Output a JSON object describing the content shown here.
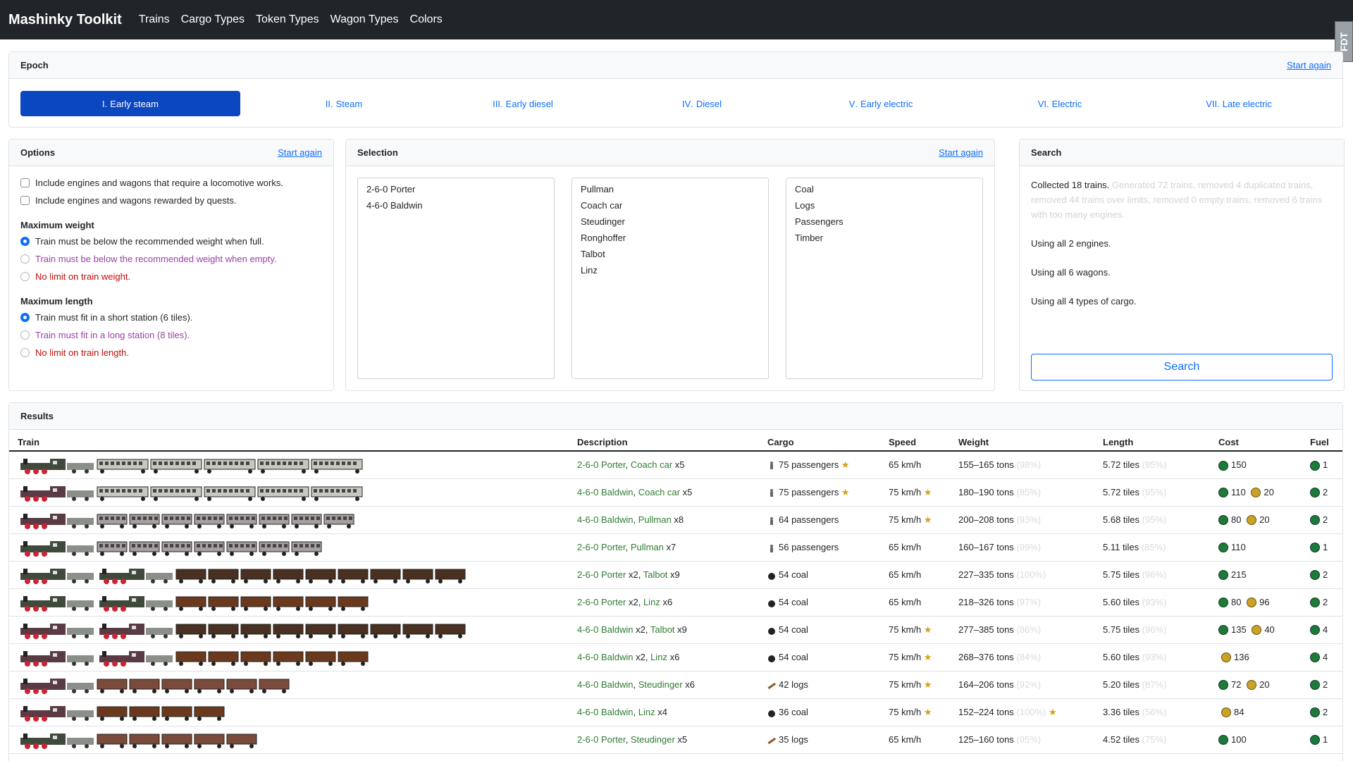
{
  "nav": {
    "brand": "Mashinky Toolkit",
    "links": [
      "Trains",
      "Cargo Types",
      "Token Types",
      "Wagon Types",
      "Colors"
    ]
  },
  "fdt": "FDT",
  "epoch": {
    "title": "Epoch",
    "start_again": "Start again",
    "items": [
      {
        "num": "I",
        "label": "Early steam"
      },
      {
        "num": "II",
        "label": "Steam"
      },
      {
        "num": "III",
        "label": "Early diesel"
      },
      {
        "num": "IV",
        "label": "Diesel"
      },
      {
        "num": "V",
        "label": "Early electric"
      },
      {
        "num": "VI",
        "label": "Electric"
      },
      {
        "num": "VII",
        "label": "Late electric"
      }
    ]
  },
  "options": {
    "title": "Options",
    "start_again": "Start again",
    "checks": [
      "Include engines and wagons that require a locomotive works.",
      "Include engines and wagons rewarded by quests."
    ],
    "weight_title": "Maximum weight",
    "weight": [
      "Train must be below the recommended weight when full.",
      "Train must be below the recommended weight when empty.",
      "No limit on train weight."
    ],
    "length_title": "Maximum length",
    "length": [
      "Train must fit in a short station (6 tiles).",
      "Train must fit in a long station (8 tiles).",
      "No limit on train length."
    ]
  },
  "selection": {
    "title": "Selection",
    "start_again": "Start again",
    "engines": [
      "2-6-0 Porter",
      "4-6-0 Baldwin"
    ],
    "wagons": [
      "Pullman",
      "Coach car",
      "Steudinger",
      "Ronghoffer",
      "Talbot",
      "Linz"
    ],
    "cargo": [
      "Coal",
      "Logs",
      "Passengers",
      "Timber"
    ]
  },
  "search": {
    "title": "Search",
    "collected": "Collected 18 trains.",
    "details": "Generated 72 trains, removed 4 duplicated trains, removed 44 trains over limits, removed 0 empty trains, removed 6 trains with too many engines.",
    "engines": "Using all 2 engines.",
    "wagons": "Using all 6 wagons.",
    "cargo": "Using all 4 types of cargo.",
    "button": "Search"
  },
  "results": {
    "title": "Results",
    "headers": [
      "Train",
      "Description",
      "Cargo",
      "Speed",
      "Weight",
      "Length",
      "Cost",
      "Fuel"
    ],
    "colors": {
      "porter": "#3f4a3c",
      "baldwin": "#5a3b44",
      "coach": "#c8c8c0",
      "pullman": "#a8a0a0",
      "talbot": "#4a3020",
      "linz": "#6b3a1e",
      "steud": "#7a4a3a"
    },
    "rows": [
      {
        "locos": [
          "porter"
        ],
        "wagon": "coach",
        "wcount": 5,
        "engine": "2-6-0 Porter",
        "eng_x": "",
        "wname": "Coach car",
        "wx": "x5",
        "cargo_icon": "passenger",
        "cargo": "75 passengers",
        "cargo_star": true,
        "speed": "65 km/h",
        "speed_star": false,
        "weight": "155–165 tons",
        "weight_pct": "(98%)",
        "weight_star": false,
        "length": "5.72 tiles",
        "length_pct": "(95%)",
        "cost_g": "150",
        "cost_y": "",
        "fuel": "1"
      },
      {
        "locos": [
          "baldwin"
        ],
        "wagon": "coach",
        "wcount": 5,
        "engine": "4-6-0 Baldwin",
        "eng_x": "",
        "wname": "Coach car",
        "wx": "x5",
        "cargo_icon": "passenger",
        "cargo": "75 passengers",
        "cargo_star": true,
        "speed": "75 km/h",
        "speed_star": true,
        "weight": "180–190 tons",
        "weight_pct": "(85%)",
        "weight_star": false,
        "length": "5.72 tiles",
        "length_pct": "(95%)",
        "cost_g": "110",
        "cost_y": "20",
        "fuel": "2"
      },
      {
        "locos": [
          "baldwin"
        ],
        "wagon": "pullman",
        "wcount": 8,
        "engine": "4-6-0 Baldwin",
        "eng_x": "",
        "wname": "Pullman",
        "wx": "x8",
        "cargo_icon": "passenger",
        "cargo": "64 passengers",
        "cargo_star": false,
        "speed": "75 km/h",
        "speed_star": true,
        "weight": "200–208 tons",
        "weight_pct": "(93%)",
        "weight_star": false,
        "length": "5.68 tiles",
        "length_pct": "(95%)",
        "cost_g": "80",
        "cost_y": "20",
        "fuel": "2"
      },
      {
        "locos": [
          "porter"
        ],
        "wagon": "pullman",
        "wcount": 7,
        "engine": "2-6-0 Porter",
        "eng_x": "",
        "wname": "Pullman",
        "wx": "x7",
        "cargo_icon": "passenger",
        "cargo": "56 passengers",
        "cargo_star": false,
        "speed": "65 km/h",
        "speed_star": false,
        "weight": "160–167 tons",
        "weight_pct": "(99%)",
        "weight_star": false,
        "length": "5.11 tiles",
        "length_pct": "(85%)",
        "cost_g": "110",
        "cost_y": "",
        "fuel": "1"
      },
      {
        "locos": [
          "porter",
          "porter"
        ],
        "wagon": "talbot",
        "wcount": 9,
        "engine": "2-6-0 Porter",
        "eng_x": " x2",
        "wname": "Talbot",
        "wx": "x9",
        "cargo_icon": "coal",
        "cargo": "54 coal",
        "cargo_star": false,
        "speed": "65 km/h",
        "speed_star": false,
        "weight": "227–335 tons",
        "weight_pct": "(100%)",
        "weight_star": false,
        "length": "5.75 tiles",
        "length_pct": "(96%)",
        "cost_g": "215",
        "cost_y": "",
        "fuel": "2"
      },
      {
        "locos": [
          "porter",
          "porter"
        ],
        "wagon": "linz",
        "wcount": 6,
        "engine": "2-6-0 Porter",
        "eng_x": " x2",
        "wname": "Linz",
        "wx": "x6",
        "cargo_icon": "coal",
        "cargo": "54 coal",
        "cargo_star": false,
        "speed": "65 km/h",
        "speed_star": false,
        "weight": "218–326 tons",
        "weight_pct": "(97%)",
        "weight_star": false,
        "length": "5.60 tiles",
        "length_pct": "(93%)",
        "cost_g": "80",
        "cost_y": "96",
        "fuel": "2"
      },
      {
        "locos": [
          "baldwin",
          "baldwin"
        ],
        "wagon": "talbot",
        "wcount": 9,
        "engine": "4-6-0 Baldwin",
        "eng_x": " x2",
        "wname": "Talbot",
        "wx": "x9",
        "cargo_icon": "coal",
        "cargo": "54 coal",
        "cargo_star": false,
        "speed": "75 km/h",
        "speed_star": true,
        "weight": "277–385 tons",
        "weight_pct": "(86%)",
        "weight_star": false,
        "length": "5.75 tiles",
        "length_pct": "(96%)",
        "cost_g": "135",
        "cost_y": "40",
        "fuel": "4"
      },
      {
        "locos": [
          "baldwin",
          "baldwin"
        ],
        "wagon": "linz",
        "wcount": 6,
        "engine": "4-6-0 Baldwin",
        "eng_x": " x2",
        "wname": "Linz",
        "wx": "x6",
        "cargo_icon": "coal",
        "cargo": "54 coal",
        "cargo_star": false,
        "speed": "75 km/h",
        "speed_star": true,
        "weight": "268–376 tons",
        "weight_pct": "(84%)",
        "weight_star": false,
        "length": "5.60 tiles",
        "length_pct": "(93%)",
        "cost_g": "",
        "cost_y": "136",
        "fuel": "4"
      },
      {
        "locos": [
          "baldwin"
        ],
        "wagon": "steud",
        "wcount": 6,
        "engine": "4-6-0 Baldwin",
        "eng_x": "",
        "wname": "Steudinger",
        "wx": "x6",
        "cargo_icon": "logs",
        "cargo": "42 logs",
        "cargo_star": false,
        "speed": "75 km/h",
        "speed_star": true,
        "weight": "164–206 tons",
        "weight_pct": "(92%)",
        "weight_star": false,
        "length": "5.20 tiles",
        "length_pct": "(87%)",
        "cost_g": "72",
        "cost_y": "20",
        "fuel": "2"
      },
      {
        "locos": [
          "baldwin"
        ],
        "wagon": "linz",
        "wcount": 4,
        "engine": "4-6-0 Baldwin",
        "eng_x": "",
        "wname": "Linz",
        "wx": "x4",
        "cargo_icon": "coal",
        "cargo": "36 coal",
        "cargo_star": false,
        "speed": "75 km/h",
        "speed_star": true,
        "weight": "152–224 tons",
        "weight_pct": "(100%)",
        "weight_star": true,
        "length": "3.36 tiles",
        "length_pct": "(56%)",
        "cost_g": "",
        "cost_y": "84",
        "fuel": "2"
      },
      {
        "locos": [
          "porter"
        ],
        "wagon": "steud",
        "wcount": 5,
        "engine": "2-6-0 Porter",
        "eng_x": "",
        "wname": "Steudinger",
        "wx": "x5",
        "cargo_icon": "logs",
        "cargo": "35 logs",
        "cargo_star": false,
        "speed": "65 km/h",
        "speed_star": false,
        "weight": "125–160 tons",
        "weight_pct": "(95%)",
        "weight_star": false,
        "length": "4.52 tiles",
        "length_pct": "(75%)",
        "cost_g": "100",
        "cost_y": "",
        "fuel": "1"
      }
    ]
  }
}
